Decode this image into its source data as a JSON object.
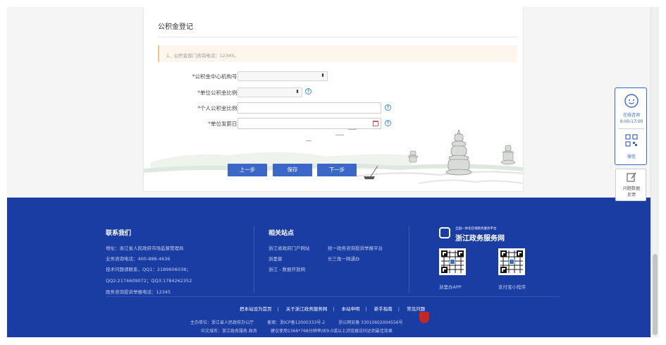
{
  "form": {
    "title": "公积金登记",
    "notice": "1、公积金部门咨询电话：12345。",
    "fields": [
      {
        "required_mark": "*",
        "label": "公积金中心机构号："
      },
      {
        "required_mark": "*",
        "label": "单位公积金比例："
      },
      {
        "required_mark": "*",
        "label": "个人公积金比例："
      },
      {
        "required_mark": "*",
        "label": "单位发薪日："
      }
    ],
    "buttons": {
      "prev": "上一步",
      "save": "保存",
      "next": "下一步"
    }
  },
  "float_panel": {
    "online_label": "在线咨询",
    "online_hours": "9:00-17:00",
    "wechat_label": "微信",
    "feedback_label_1": "问题数据",
    "feedback_label_2": "反馈"
  },
  "footer": {
    "contact": {
      "heading": "联系我们",
      "lines": [
        "地址：浙江省人民政府市场监督管理局",
        "业务咨询电话：400-888-4636",
        "技术问题请联系，QQ1：2189606038；",
        "QQ2:2174609072；QQ3:1784262352",
        "政务咨询投诉举报电话：12345"
      ]
    },
    "related": {
      "heading": "相关站点",
      "links": [
        "浙江省政府门户网站",
        "统一政务咨询投诉举报平台",
        "浙里督",
        "长三角一网通办",
        "浙江 - 数据开放网"
      ]
    },
    "brand": {
      "small_text": "全国一体化在线政务服务平台",
      "name": "浙江政务服务网",
      "qr1_caption": "浙里办APP",
      "qr2_caption": "支付宝小程序"
    },
    "bottom_links": [
      "把本站设为首页",
      "关于浙江政务服务网",
      "本站申明",
      "新手指南",
      "常见问题"
    ],
    "info_line_1": "主办单位：浙江省人民政府办公厅          备案：浙ICP备12000333号-2          浙公网安备 33010602004556号",
    "info_line_2": "中文域名：浙江政务服务.政务          建议使用1366*768分辨率/IE9.0或以上浏览器访问达到最佳效果"
  },
  "colors": {
    "primary": "#3b67c9",
    "footer_bg": "#1a3da3",
    "required": "#e02020",
    "notice_bg": "#fdf6ec"
  }
}
